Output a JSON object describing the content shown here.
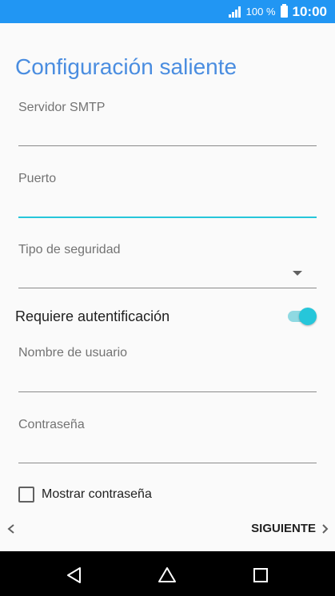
{
  "status_bar": {
    "battery_percent": "100 %",
    "time": "10:00",
    "signal_icon": "signal-icon",
    "battery_icon": "battery-icon"
  },
  "page": {
    "title": "Configuración saliente"
  },
  "fields": {
    "smtp_server": {
      "label": "Servidor SMTP",
      "value": ""
    },
    "port": {
      "label": "Puerto",
      "value": ""
    },
    "security_type": {
      "label": "Tipo de seguridad",
      "value": ""
    },
    "username": {
      "label": "Nombre de usuario",
      "value": ""
    },
    "password": {
      "label": "Contraseña",
      "value": ""
    }
  },
  "auth_toggle": {
    "label": "Requiere autentificación",
    "on": true
  },
  "show_password": {
    "label": "Mostrar contraseña",
    "checked": false
  },
  "navigation": {
    "back_icon": "chevron-left-icon",
    "next_label": "SIGUIENTE",
    "next_icon": "chevron-right-icon"
  },
  "system_nav": {
    "back": "back-triangle-icon",
    "home": "home-icon",
    "recents": "recents-icon"
  },
  "colors": {
    "accent": "#26c6da",
    "title": "#4a8de0",
    "status_bar": "#2196f3"
  }
}
